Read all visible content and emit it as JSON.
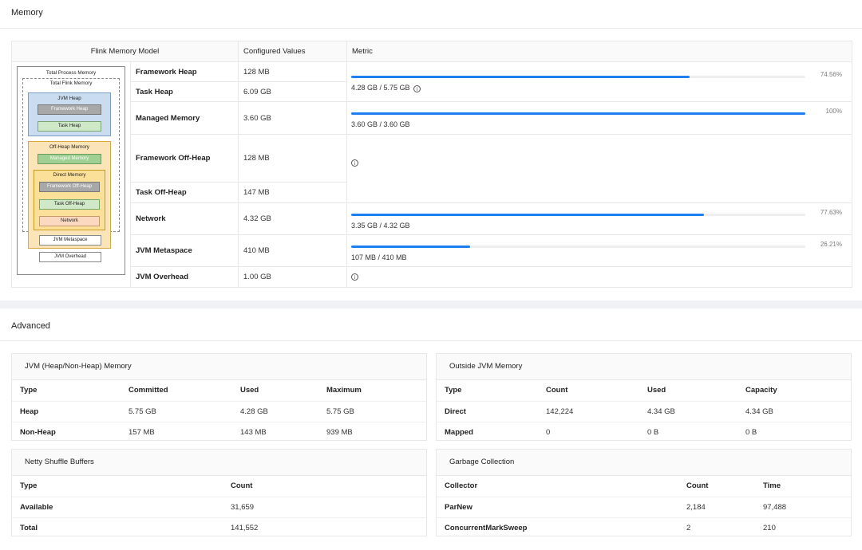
{
  "memory": {
    "title": "Memory",
    "headers": [
      "Flink Memory Model",
      "Configured Values",
      "Metric"
    ],
    "diagram": {
      "total_process": "Total Process Memory",
      "total_flink": "Total Flink Memory",
      "jvm_heap": "JVM Heap",
      "framework_heap": "Framework Heap",
      "task_heap": "Task Heap",
      "off_heap": "Off-Heap Memory",
      "managed": "Managed Memory",
      "direct": "Direct Memory",
      "framework_off_heap": "Framework Off-Heap",
      "task_off_heap": "Task Off-Heap",
      "network": "Network",
      "jvm_metaspace": "JVM Metaspace",
      "jvm_overhead": "JVM Overhead"
    },
    "rows": [
      {
        "label": "Framework Heap",
        "value": "128 MB"
      },
      {
        "label": "Task Heap",
        "value": "6.09 GB"
      },
      {
        "label": "Managed Memory",
        "value": "3.60 GB"
      },
      {
        "label": "Framework Off-Heap",
        "value": "128 MB"
      },
      {
        "label": "Task Off-Heap",
        "value": "147 MB"
      },
      {
        "label": "Network",
        "value": "4.32 GB"
      },
      {
        "label": "JVM Metaspace",
        "value": "410 MB"
      },
      {
        "label": "JVM Overhead",
        "value": "1.00 GB"
      }
    ],
    "metrics": {
      "heap": {
        "pct": "74.56%",
        "fraction": 0.7456,
        "text": "4.28 GB / 5.75 GB"
      },
      "managed": {
        "pct": "100%",
        "fraction": 1.0,
        "text": "3.60 GB / 3.60 GB"
      },
      "network": {
        "pct": "77.63%",
        "fraction": 0.7763,
        "text": "3.35 GB / 4.32 GB"
      },
      "metaspace": {
        "pct": "26.21%",
        "fraction": 0.2621,
        "text": "107 MB / 410 MB"
      }
    },
    "info_glyph": "i",
    "bar_color": "#1f7ef0"
  },
  "advanced": {
    "title": "Advanced",
    "jvm": {
      "title": "JVM (Heap/Non-Heap) Memory",
      "headers": [
        "Type",
        "Committed",
        "Used",
        "Maximum"
      ],
      "rows": [
        [
          "Heap",
          "5.75 GB",
          "4.28 GB",
          "5.75 GB"
        ],
        [
          "Non-Heap",
          "157 MB",
          "143 MB",
          "939 MB"
        ]
      ]
    },
    "outside": {
      "title": "Outside JVM Memory",
      "headers": [
        "Type",
        "Count",
        "Used",
        "Capacity"
      ],
      "rows": [
        [
          "Direct",
          "142,224",
          "4.34 GB",
          "4.34 GB"
        ],
        [
          "Mapped",
          "0",
          "0 B",
          "0 B"
        ]
      ]
    },
    "netty": {
      "title": "Netty Shuffle Buffers",
      "headers": [
        "Type",
        "Count"
      ],
      "rows": [
        [
          "Available",
          "31,659"
        ],
        [
          "Total",
          "141,552"
        ]
      ]
    },
    "gc": {
      "title": "Garbage Collection",
      "headers": [
        "Collector",
        "Count",
        "Time"
      ],
      "rows": [
        [
          "ParNew",
          "2,184",
          "97,488"
        ],
        [
          "ConcurrentMarkSweep",
          "2",
          "210"
        ]
      ]
    }
  }
}
